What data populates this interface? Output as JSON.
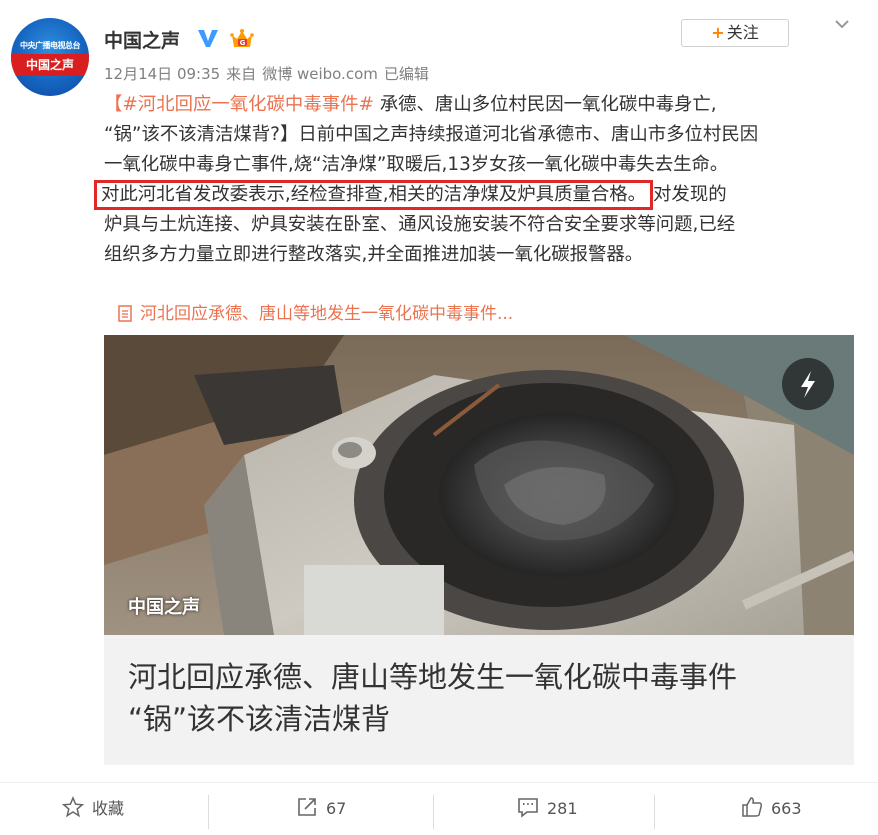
{
  "header": {
    "avatar_top_text": "中央广播电视总台",
    "avatar_band_text": "中国之声",
    "name": "中国之声",
    "follow_label": "关注",
    "follow_plus": "+"
  },
  "meta": {
    "date": "12月14日 09:35",
    "source_prefix": "来自",
    "source": "微博 weibo.com",
    "edited": "已编辑"
  },
  "post": {
    "hashtag": "【#河北回应一氧化碳中毒事件#",
    "line1_rest": " 承德、唐山多位村民因一氧化碳中毒身亡,",
    "line2": "“锅”该不该清洁煤背?】日前中国之声持续报道河北省承德市、唐山市多位村民因",
    "line3": "一氧化碳中毒身亡事件,烧“洁净煤”取暖后,13岁女孩一氧化碳中毒失去生命。",
    "highlight": "对此河北省发改委表示,经检查排查,相关的洁净煤及炉具质量合格。",
    "line4_rest": "对发现的",
    "line5": "炉具与土炕连接、炉具安装在卧室、通风设施安装不符合安全要求等问题,已经",
    "line6": "组织多方力量立即进行整改落实,并全面推进加装一氧化碳报警器。",
    "article_link": "河北回应承德、唐山等地发生一氧化碳中毒事件..."
  },
  "card": {
    "watermark": "中国之声",
    "title_line1": "河北回应承德、唐山等地发生一氧化碳中毒事件",
    "title_line2": "“锅”该不该清洁煤背"
  },
  "footer": {
    "favorite_label": "收藏",
    "repost_count": "67",
    "comment_count": "281",
    "like_count": "663"
  },
  "colors": {
    "link": "#eb7350",
    "highlight_border": "#e02828",
    "follow_plus": "#ff8200",
    "verified_badge": "#3b9cff"
  },
  "icons": [
    "verified-icon",
    "crown-icon",
    "chevron-down-icon",
    "article-icon",
    "flash-icon",
    "star-icon",
    "repost-icon",
    "comment-icon",
    "like-icon"
  ]
}
